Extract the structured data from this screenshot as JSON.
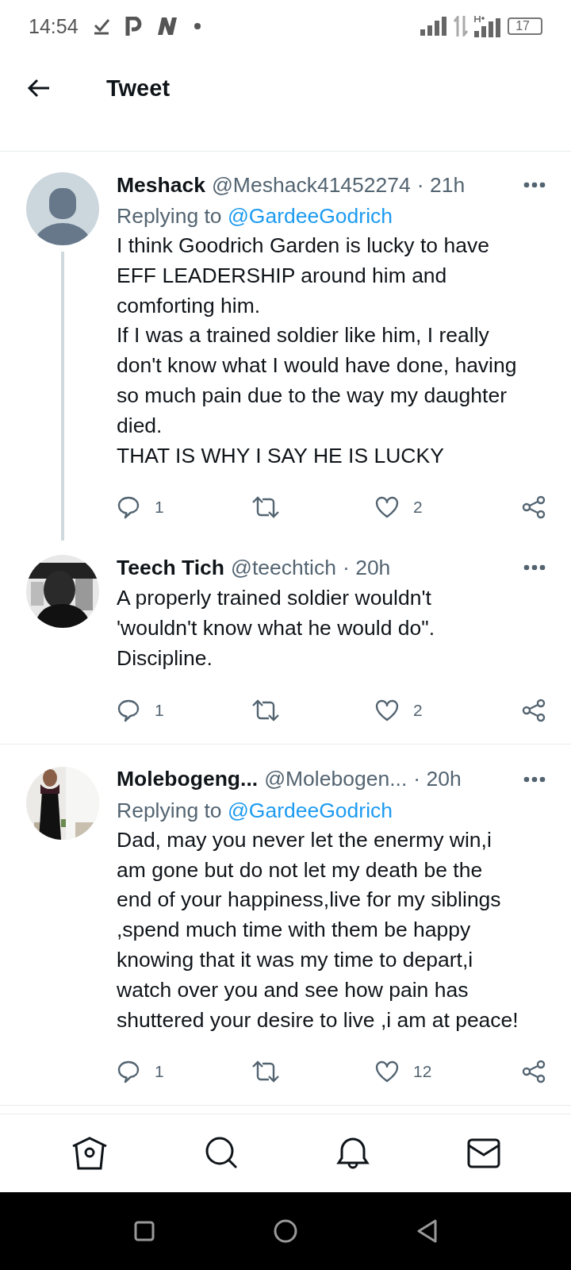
{
  "status_bar": {
    "time": "14:54",
    "battery": "17"
  },
  "header": {
    "title": "Tweet"
  },
  "tweets": [
    {
      "avatar": {
        "kind": "default"
      },
      "name": "Meshack",
      "handle": "@Meshack41452274",
      "time": "· 21h",
      "replying_prefix": "Replying to",
      "replying_handle": "@GardeeGodrich",
      "body": [
        "I think Goodrich Garden is lucky to have",
        "EFF LEADERSHIP around him and",
        "comforting him.",
        "If I was a trained soldier like him, I really",
        "don't know what I would have done, having",
        "so much pain due to the way my daughter",
        "died.",
        "THAT IS WHY I SAY HE IS LUCKY"
      ],
      "replies": "1",
      "likes": "2",
      "thread_line": true
    },
    {
      "avatar": {
        "kind": "picture"
      },
      "name": "Teech Tich",
      "handle": "@teechtich",
      "time": "· 20h",
      "body": [
        "A properly trained soldier wouldn't",
        "'wouldn't know what he would do\".",
        "Discipline."
      ],
      "replies": "1",
      "likes": "2",
      "thread_line": false
    },
    {
      "avatar": {
        "kind": "picture"
      },
      "name": "Molebogeng...",
      "handle": "@Molebogen...",
      "time": "· 20h",
      "replying_prefix": "Replying to",
      "replying_handle": "@GardeeGodrich",
      "body": [
        "Dad, may you never let the enermy win,i",
        "am gone but do not let my death be the",
        "end of your happiness,live for my siblings",
        ",spend much time with them be happy",
        "knowing that it was my time to depart,i",
        "watch over you and see how pain has",
        "shuttered your desire to live ,i am at peace!"
      ],
      "replies": "1",
      "likes": "12",
      "thread_line": false
    }
  ]
}
